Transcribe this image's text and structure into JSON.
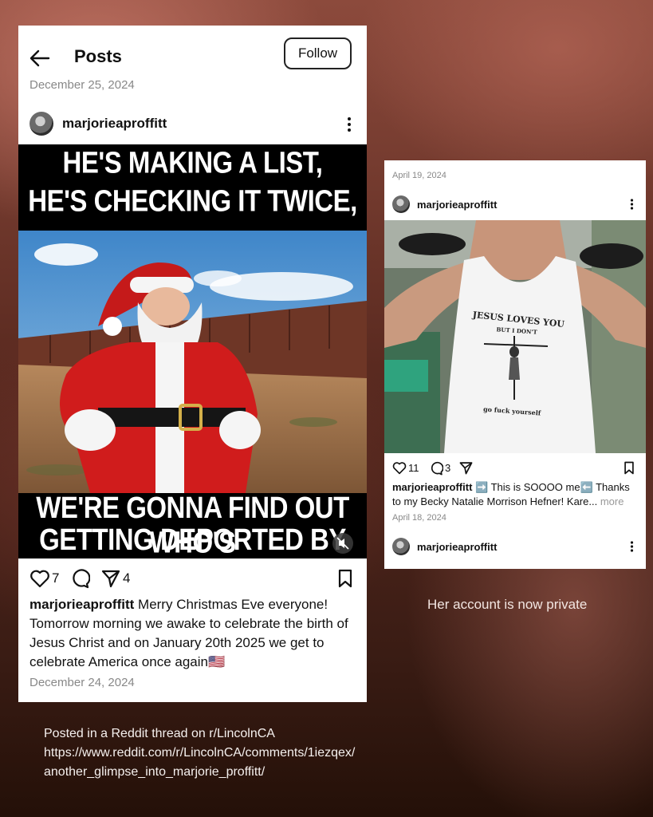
{
  "left_post": {
    "header_title": "Posts",
    "follow_label": "Follow",
    "date_top": "December 25, 2024",
    "username": "marjorieaproffitt",
    "meme": {
      "top_line_1": "HE'S MAKING A LIST,",
      "top_line_2": "HE'S CHECKING IT TWICE,",
      "bottom_line_1": "WE'RE GONNA FIND OUT WHO'S",
      "bottom_line_2": "GETTING DEPORTED BY ICE..."
    },
    "likes": "7",
    "shares": "4",
    "caption_user": "marjorieaproffitt",
    "caption_text": "Merry Christmas Eve everyone! Tomorrow morning we awake to celebrate the birth of Jesus Christ and on January 20th 2025 we get to celebrate America once again🇺🇸",
    "date_bottom": "December 24, 2024"
  },
  "right_post": {
    "date_top": "April 19, 2024",
    "username": "marjorieaproffitt",
    "shirt_text_1": "JESUS LOVES YOU",
    "shirt_text_2": "BUT I DON'T",
    "shirt_text_3": "go fuck yourself",
    "likes": "11",
    "comments": "3",
    "caption_user": "marjorieaproffitt",
    "caption_text": "➡️ This is SOOOO me⬅️ Thanks to my Becky Natalie Morrison Hefner! Kare...",
    "caption_more": "more",
    "date_bottom": "April 18, 2024",
    "next_username": "marjorieaproffitt"
  },
  "private_note": "Her account is now private",
  "footer": {
    "line_1": "Posted in a Reddit thread on r/LincolnCA",
    "line_2": "https://www.reddit.com/r/LincolnCA/comments/1iezqex/",
    "line_3": "another_glimpse_into_marjorie_proffitt/"
  },
  "icons": {
    "back": "arrow-left-icon",
    "heart": "heart-icon",
    "comment": "comment-icon",
    "share": "send-icon",
    "save": "bookmark-icon",
    "more": "more-vertical-icon",
    "mute": "mute-icon"
  }
}
